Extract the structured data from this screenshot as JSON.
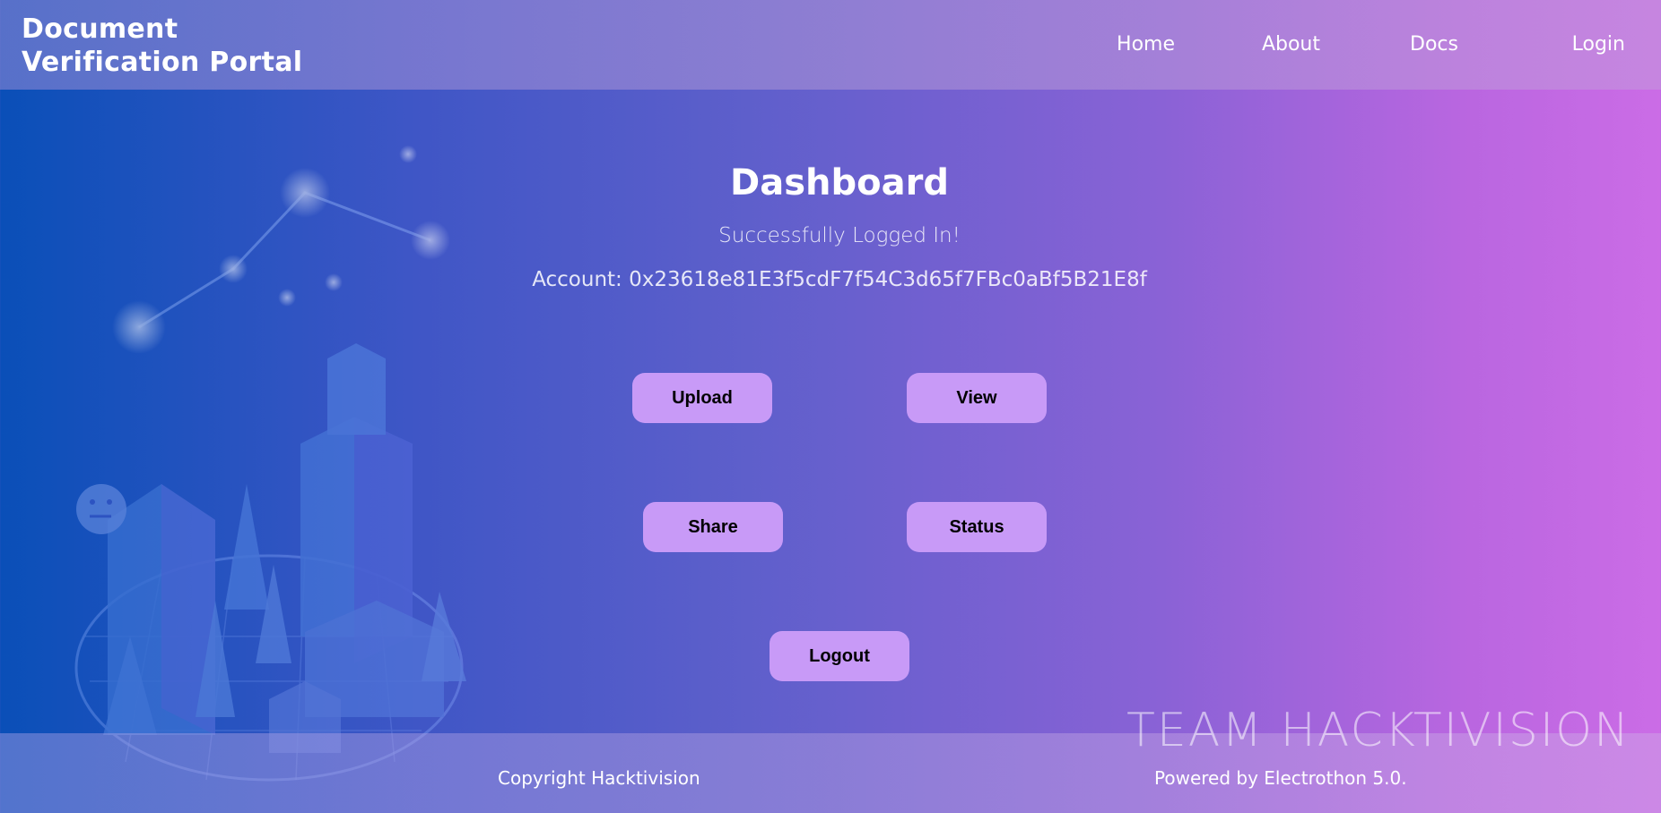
{
  "header": {
    "brand_line1": "Document",
    "brand_line2": "Verification Portal",
    "nav": [
      "Home",
      "About",
      "Docs",
      "Login"
    ]
  },
  "main": {
    "title": "Dashboard",
    "subtitle": "Successfully Logged In!",
    "account": "Account: 0x23618e81E3f5cdF7f54C3d65f7FBc0aBf5B21E8f",
    "buttons": {
      "upload": "Upload",
      "view": "View",
      "share": "Share",
      "status": "Status",
      "logout": "Logout"
    }
  },
  "footer": {
    "watermark": "TEAM  HACKTIVISION",
    "copyright": "Copyright Hacktivision",
    "powered": "Powered by Electrothon 5.0."
  },
  "colors": {
    "button_bg": "#c89af7",
    "gradient_start": "#0a4fb8",
    "gradient_end": "#cb6ce6"
  }
}
